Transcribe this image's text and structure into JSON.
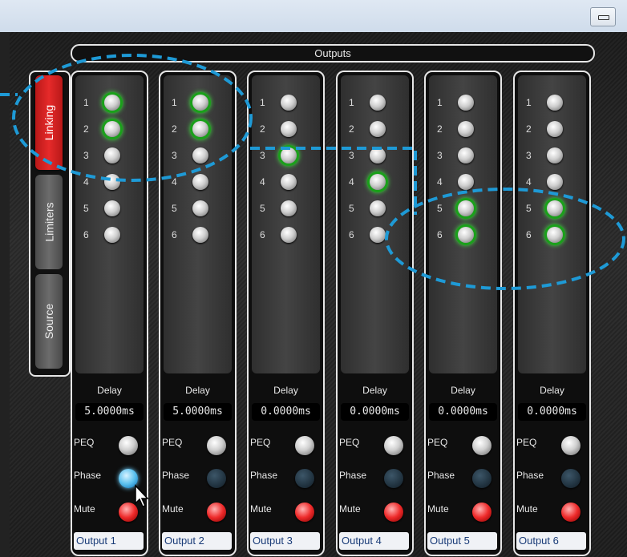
{
  "window": {
    "minimize_icon": "minimize-icon"
  },
  "header": {
    "title": "Outputs"
  },
  "side_tabs": [
    {
      "label": "Linking",
      "active": true
    },
    {
      "label": "Limiters",
      "active": false
    },
    {
      "label": "Source",
      "active": false
    }
  ],
  "row_numbers": [
    "1",
    "2",
    "3",
    "4",
    "5",
    "6"
  ],
  "labels": {
    "delay": "Delay",
    "peq": "PEQ",
    "phase": "Phase",
    "mute": "Mute"
  },
  "outputs": [
    {
      "name": "Output 1",
      "delay": "5.0000ms",
      "links": [
        true,
        true,
        false,
        false,
        false,
        false
      ],
      "phase_on": true
    },
    {
      "name": "Output 2",
      "delay": "5.0000ms",
      "links": [
        true,
        true,
        false,
        false,
        false,
        false
      ],
      "phase_on": false
    },
    {
      "name": "Output 3",
      "delay": "0.0000ms",
      "links": [
        false,
        false,
        true,
        false,
        false,
        false
      ],
      "phase_on": false
    },
    {
      "name": "Output 4",
      "delay": "0.0000ms",
      "links": [
        false,
        false,
        false,
        true,
        false,
        false
      ],
      "phase_on": false
    },
    {
      "name": "Output 5",
      "delay": "0.0000ms",
      "links": [
        false,
        false,
        false,
        false,
        true,
        true
      ],
      "phase_on": false
    },
    {
      "name": "Output 6",
      "delay": "0.0000ms",
      "links": [
        false,
        false,
        false,
        false,
        true,
        true
      ],
      "phase_on": false
    }
  ],
  "colors": {
    "link_glow": "#3ee03e",
    "active_tab": "#e62a2a",
    "annotation": "#1e9ad6",
    "phase_on": "#5cc1ee",
    "mute": "#ee2a2a"
  }
}
